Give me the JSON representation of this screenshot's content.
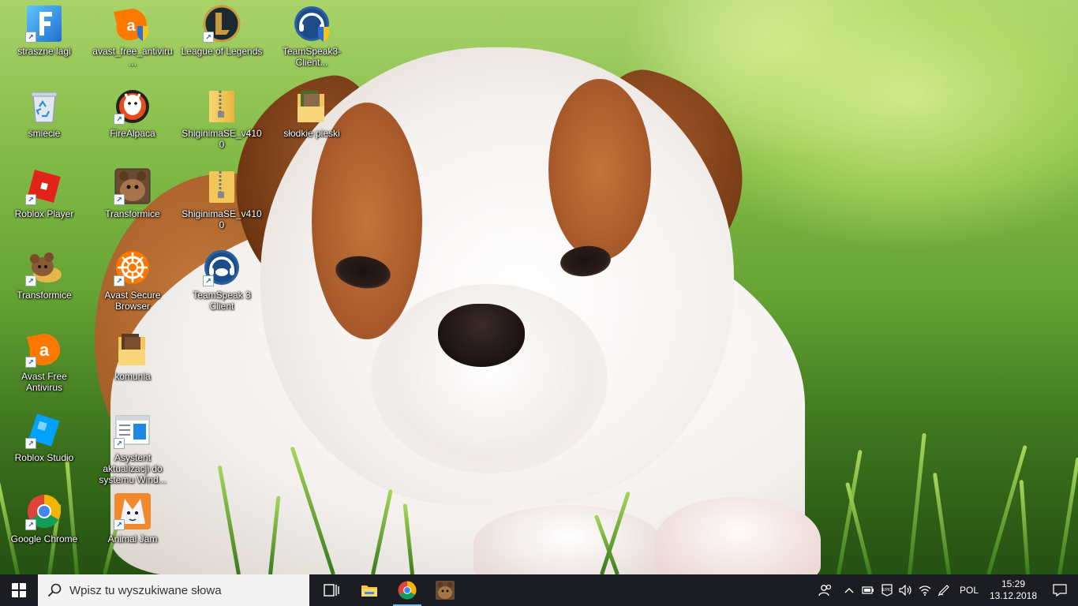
{
  "desktop": {
    "icons": [
      {
        "label": "straszne lagi",
        "icon": "fortnite-f-icon"
      },
      {
        "label": "śmiecie",
        "icon": "recycle-bin-icon"
      },
      {
        "label": "Roblox Player",
        "icon": "roblox-player-icon"
      },
      {
        "label": "Transformice",
        "icon": "transformice-mouse-icon"
      },
      {
        "label": "Avast Free Antivirus",
        "icon": "avast-icon"
      },
      {
        "label": "Roblox Studio",
        "icon": "roblox-studio-icon"
      },
      {
        "label": "Google Chrome",
        "icon": "chrome-icon"
      },
      {
        "label": "avast_free_antiviru...",
        "icon": "avast-installer-icon"
      },
      {
        "label": "FireAlpaca",
        "icon": "firealpaca-icon"
      },
      {
        "label": "Transformice",
        "icon": "transformice-icon"
      },
      {
        "label": "Avast Secure Browser",
        "icon": "avast-browser-icon"
      },
      {
        "label": "komunia",
        "icon": "folder-images-icon"
      },
      {
        "label": "Asystent aktualizacji do systemu Wind...",
        "icon": "windows-update-assistant-icon"
      },
      {
        "label": "Animal Jam",
        "icon": "animal-jam-icon"
      },
      {
        "label": "League of Legends",
        "icon": "league-of-legends-icon"
      },
      {
        "label": "ShiginimaSE_v4100",
        "icon": "zip-folder-icon"
      },
      {
        "label": "ShiginimaSE_v4100",
        "icon": "zip-folder-icon"
      },
      {
        "label": "TeamSpeak 3 Client",
        "icon": "teamspeak-icon"
      },
      {
        "label": "TeamSpeak3-Client...",
        "icon": "teamspeak-installer-icon"
      },
      {
        "label": "słodkie pieski",
        "icon": "folder-images-icon"
      }
    ]
  },
  "taskbar": {
    "search_placeholder": "Wpisz tu wyszukiwane słowa",
    "pinned": [
      "task-view-icon",
      "file-explorer-icon",
      "chrome-icon",
      "transformice-icon"
    ],
    "active_app": "chrome-icon",
    "tray": {
      "language": "POL",
      "time": "15:29",
      "date": "13.12.2018"
    }
  },
  "colors": {
    "taskbar_bg": "#1c1d22",
    "search_bg": "#f3f3f3",
    "accent": "#76b9ed"
  }
}
